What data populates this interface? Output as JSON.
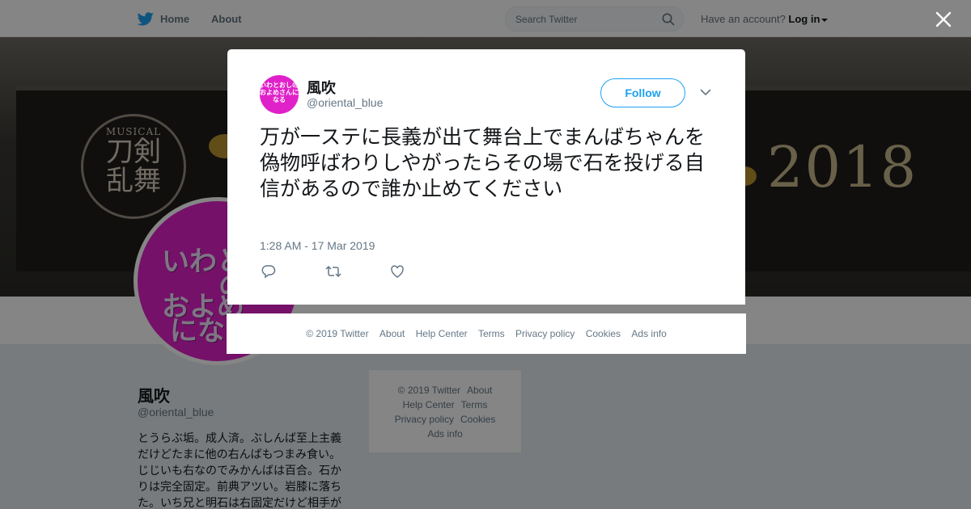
{
  "nav": {
    "home_label": "Home",
    "about_label": "About",
    "search_placeholder": "Search Twitter",
    "account_text": "Have an account?",
    "login_label": "Log in"
  },
  "banner": {
    "logo_top": "MUSICAL",
    "logo_main": "刀剣\n乱舞",
    "year": "2018"
  },
  "profile": {
    "avatar_text": [
      "いわと",
      "の",
      "およめ",
      "になる"
    ],
    "name": "風吹",
    "handle": "@oriental_blue",
    "bio": "とうらぶ垢。成人済。ぶしんば至上主義だけどたまに他の右んばもつまみ食い。じじいも右なのでみかんばは百合。石かりは完全固定。前典アツい。岩膝に落ちた。いち兄と明石は右固定だけど相手が"
  },
  "side_footer": {
    "links": [
      "© 2019 Twitter",
      "About",
      "Help Center",
      "Terms",
      "Privacy policy",
      "Cookies",
      "Ads info"
    ]
  },
  "tweet": {
    "avatar_text": "いわとおしのおよめさんになる",
    "name": "風吹",
    "handle": "@oriental_blue",
    "follow_label": "Follow",
    "text": "万が一ステに長義が出て舞台上でまんばちゃんを偽物呼ばわりしやがったらその場で石を投げる自信があるので誰か止めてください",
    "timestamp": "1:28 AM - 17 Mar 2019",
    "actions": [
      "reply-icon",
      "retweet-icon",
      "like-icon"
    ]
  },
  "modal_footer": {
    "links": [
      "© 2019 Twitter",
      "About",
      "Help Center",
      "Terms",
      "Privacy policy",
      "Cookies",
      "Ads info"
    ]
  },
  "colors": {
    "twitter_blue": "#1da1f2",
    "avatar_magenta": "#e021c9"
  }
}
